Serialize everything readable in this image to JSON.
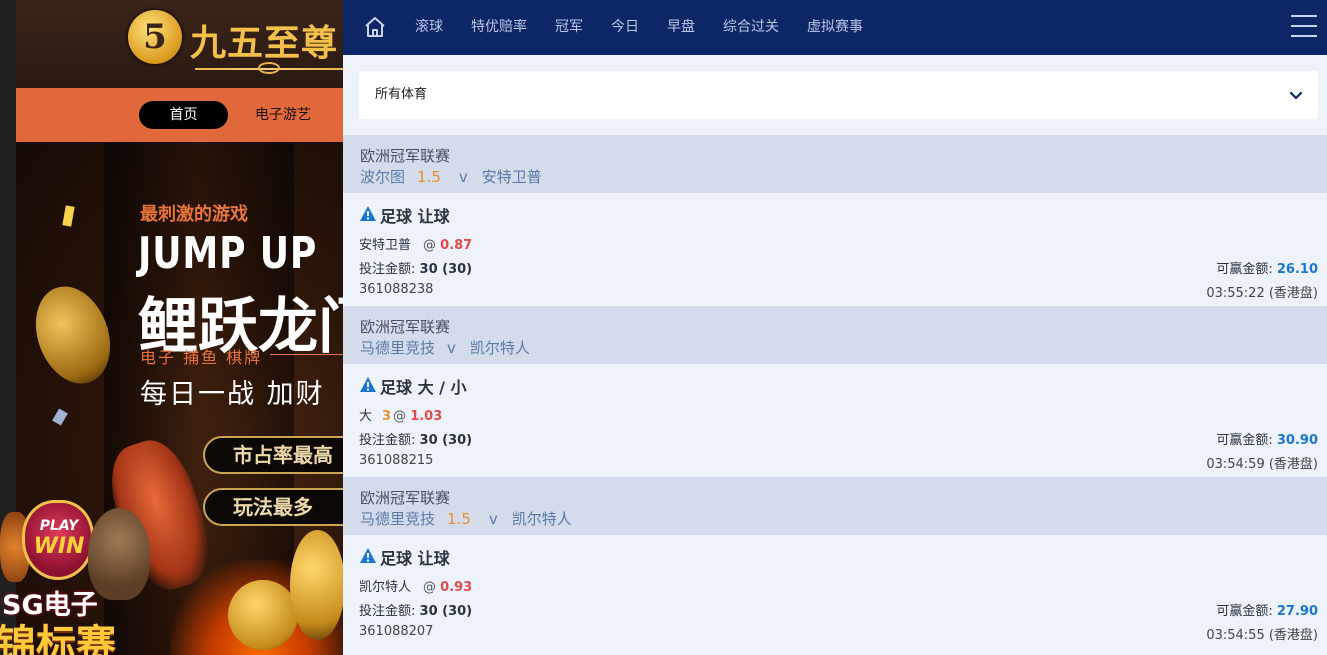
{
  "background_site": {
    "logo_number": "5",
    "logo_text": "九五至尊",
    "nav": {
      "home": "首页",
      "slots": "电子游艺"
    },
    "banner": {
      "tagline": "最刺激的游戏",
      "title_en": "JUMP UP",
      "title_cn": "鲤跃龙门",
      "categories": "电子 捕鱼 棋牌",
      "slogan": "每日一战 加财",
      "pill_1": "市占率最高",
      "pill_2": "玩法最多"
    },
    "promo": {
      "play": "PLAY",
      "win": "WIN",
      "sg": "SG电子",
      "champion": "锦标赛"
    }
  },
  "topnav": {
    "items": [
      "滚球",
      "特优赔率",
      "冠军",
      "今日",
      "早盘",
      "综合过关",
      "虚拟赛事"
    ]
  },
  "sport_select": {
    "value": "所有体育"
  },
  "bets": [
    {
      "league": "欧洲冠军联赛",
      "home": "波尔图",
      "handicap": "1.5",
      "vs": "v",
      "away": "安特卫普",
      "market": "足球 让球",
      "selection": "安特卫普",
      "line": "",
      "odds_prefix": "@",
      "odds": "0.87",
      "stake_label": "投注金额:",
      "stake": "30 (30)",
      "towin_label": "可赢金额:",
      "towin": "26.10",
      "ticket_id": "361088238",
      "time": "03:55:22 (香港盘)"
    },
    {
      "league": "欧洲冠军联赛",
      "home": "马德里竞技",
      "handicap": "",
      "vs": "v",
      "away": "凯尔特人",
      "market": "足球 大 / 小",
      "selection": "大",
      "line": "3",
      "odds_prefix": "@",
      "odds": "1.03",
      "stake_label": "投注金额:",
      "stake": "30 (30)",
      "towin_label": "可赢金额:",
      "towin": "30.90",
      "ticket_id": "361088215",
      "time": "03:54:59 (香港盘)"
    },
    {
      "league": "欧洲冠军联赛",
      "home": "马德里竞技",
      "handicap": "1.5",
      "vs": "v",
      "away": "凯尔特人",
      "market": "足球 让球",
      "selection": "凯尔特人",
      "line": "",
      "odds_prefix": "@",
      "odds": "0.93",
      "stake_label": "投注金额:",
      "stake": "30 (30)",
      "towin_label": "可赢金额:",
      "towin": "27.90",
      "ticket_id": "361088207",
      "time": "03:54:55 (香港盘)"
    }
  ],
  "colors": {
    "nav_bg": "#0c2666",
    "league_bg": "#d4dcec",
    "card_bg": "#eef3fb",
    "odds": "#e24b4b",
    "handicap": "#e8902a",
    "towin": "#1a76d2",
    "warn_icon": "#1a76d2"
  },
  "icons": [
    "home-icon",
    "menu-icon",
    "chevron-down-icon",
    "warning-icon"
  ]
}
